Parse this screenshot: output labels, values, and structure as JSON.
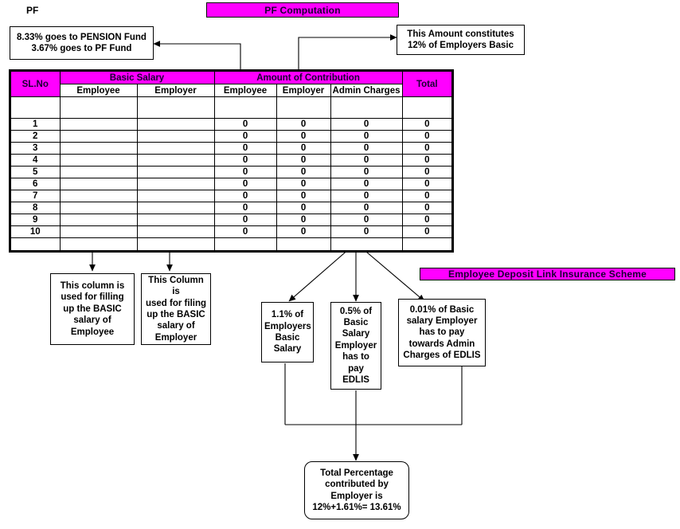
{
  "page": {
    "corner_label": "PF",
    "title_bar": "PF Computation",
    "edlis_bar": "Employee Deposit Link Insurance Scheme"
  },
  "colors": {
    "accent": "#FF00FF",
    "bar_text": "#1a0033",
    "line": "#000000",
    "background": "#FFFFFF"
  },
  "notes": {
    "pension_split": {
      "line1": "8.33% goes to PENSION Fund",
      "line2": "3.67% goes to PF Fund"
    },
    "employer_basic": {
      "line1": "This Amount constitutes",
      "line2": "12% of Employers Basic"
    },
    "employee_column": {
      "line1": "This column is",
      "line2": "used for filling",
      "line3": "up the BASIC",
      "line4": "salary of",
      "line5": "Employee"
    },
    "employer_column": {
      "line1": "This Column is",
      "line2": "used for filing",
      "line3": "up the BASIC",
      "line4": "salary of",
      "line5": "Employer"
    },
    "edlis_employer_basic": {
      "line1": "1.1% of",
      "line2": "Employers",
      "line3": "Basic",
      "line4": "Salary"
    },
    "edlis_pay": {
      "line1": "0.5% of",
      "line2": "Basic",
      "line3": "Salary",
      "line4": "Employer",
      "line5": "has to",
      "line6": "pay EDLIS"
    },
    "edlis_admin": {
      "line1": "0.01% of Basic",
      "line2": "salary Employer",
      "line3": "has to pay",
      "line4": "towards Admin",
      "line5": "Charges of EDLIS"
    },
    "total_percentage": {
      "line1": "Total Percentage",
      "line2": "contributed by",
      "line3": "Employer is",
      "line4": "12%+1.61%= 13.61%"
    }
  },
  "table": {
    "group_headers": {
      "slno": "SL.No",
      "basic_salary": "Basic Salary",
      "amount_of_contribution": "Amount of Contribution",
      "total": "Total"
    },
    "sub_headers": {
      "basic_employee": "Employee",
      "basic_employer": "Employer",
      "contrib_employee": "Employee",
      "contrib_employer": "Employer",
      "contrib_admin": "Admin Charges"
    },
    "rows": [
      {
        "slno": "1",
        "basic_employee": "",
        "basic_employer": "",
        "contrib_employee": "0",
        "contrib_employer": "0",
        "contrib_admin": "0",
        "total": "0"
      },
      {
        "slno": "2",
        "basic_employee": "",
        "basic_employer": "",
        "contrib_employee": "0",
        "contrib_employer": "0",
        "contrib_admin": "0",
        "total": "0"
      },
      {
        "slno": "3",
        "basic_employee": "",
        "basic_employer": "",
        "contrib_employee": "0",
        "contrib_employer": "0",
        "contrib_admin": "0",
        "total": "0"
      },
      {
        "slno": "4",
        "basic_employee": "",
        "basic_employer": "",
        "contrib_employee": "0",
        "contrib_employer": "0",
        "contrib_admin": "0",
        "total": "0"
      },
      {
        "slno": "5",
        "basic_employee": "",
        "basic_employer": "",
        "contrib_employee": "0",
        "contrib_employer": "0",
        "contrib_admin": "0",
        "total": "0"
      },
      {
        "slno": "6",
        "basic_employee": "",
        "basic_employer": "",
        "contrib_employee": "0",
        "contrib_employer": "0",
        "contrib_admin": "0",
        "total": "0"
      },
      {
        "slno": "7",
        "basic_employee": "",
        "basic_employer": "",
        "contrib_employee": "0",
        "contrib_employer": "0",
        "contrib_admin": "0",
        "total": "0"
      },
      {
        "slno": "8",
        "basic_employee": "",
        "basic_employer": "",
        "contrib_employee": "0",
        "contrib_employer": "0",
        "contrib_admin": "0",
        "total": "0"
      },
      {
        "slno": "9",
        "basic_employee": "",
        "basic_employer": "",
        "contrib_employee": "0",
        "contrib_employer": "0",
        "contrib_admin": "0",
        "total": "0"
      },
      {
        "slno": "10",
        "basic_employee": "",
        "basic_employer": "",
        "contrib_employee": "0",
        "contrib_employer": "0",
        "contrib_admin": "0",
        "total": "0"
      }
    ]
  }
}
